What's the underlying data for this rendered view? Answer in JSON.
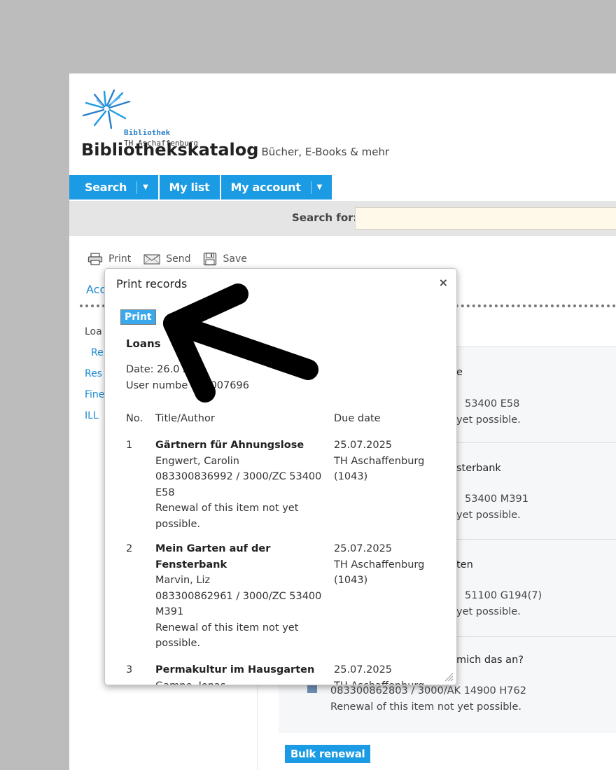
{
  "header": {
    "logo_line1": "Bibliothek",
    "logo_line2": "TH Aschaffenburg",
    "title": "Bibliothekskatalog",
    "subtitle": "Bücher, E-Books & mehr"
  },
  "nav": {
    "search": "Search",
    "my_list": "My list",
    "my_account": "My account",
    "caret": "▼"
  },
  "searchbar": {
    "label": "Search for:",
    "value": ""
  },
  "toolbar": {
    "print": "Print",
    "send": "Send",
    "save": "Save"
  },
  "sidebar": {
    "tab_partial": "Acc",
    "items": [
      "Loa",
      "Re",
      "Res",
      "Fine",
      "ILL"
    ]
  },
  "background_list": {
    "rows": [
      {
        "title_partial": "e",
        "line1_partial": "53400 E58",
        "line2_partial": "yet possible."
      },
      {
        "title_partial": "sterbank",
        "line1_partial": "53400 M391",
        "line2_partial": "yet possible."
      },
      {
        "title_partial": "ten",
        "line1_partial": "51100 G194(7)",
        "line2_partial": "yet possible."
      },
      {
        "title_partial": "mich das an?",
        "line1": "083300862803 / 3000/AK 14900 H762",
        "line2": "Renewal of this item not yet possible."
      }
    ],
    "bulk_renewal": "Bulk renewal"
  },
  "modal": {
    "title": "Print records",
    "close": "×",
    "print_button": "Print",
    "heading": "Loans",
    "date": "Date: 26.0   25",
    "user_number": "User numbe   330007696",
    "columns": {
      "no": "No.",
      "title": "Title/Author",
      "due": "Due date"
    },
    "rows": [
      {
        "no": "1",
        "title": "Gärtnern für Ahnungslose",
        "author": "Engwert, Carolin",
        "signature": "083300836992 / 3000/ZC 53400",
        "signature2": "E58",
        "note1": "Renewal of this item not yet",
        "note2": "possible.",
        "due": "25.07.2025",
        "branch": "TH Aschaffenburg",
        "branch_code": "(1043)"
      },
      {
        "no": "2",
        "title": "Mein Garten auf der",
        "title2": "Fensterbank",
        "author": "Marvin, Liz",
        "signature": "083300862961 / 3000/ZC 53400",
        "signature2": "M391",
        "note1": "Renewal of this item not yet",
        "note2": "possible.",
        "due": "25.07.2025",
        "branch": "TH Aschaffenburg",
        "branch_code": "(1043)"
      },
      {
        "no": "3",
        "title": "Permakultur im Hausgarten",
        "author": "Gampe, Jonas",
        "due": "25.07.2025",
        "branch": "TH Aschaffenburg"
      }
    ]
  },
  "colors": {
    "accent": "#1a9be3",
    "page_bg": "#bcbcbc",
    "search_input_bg": "#fff9ea"
  }
}
